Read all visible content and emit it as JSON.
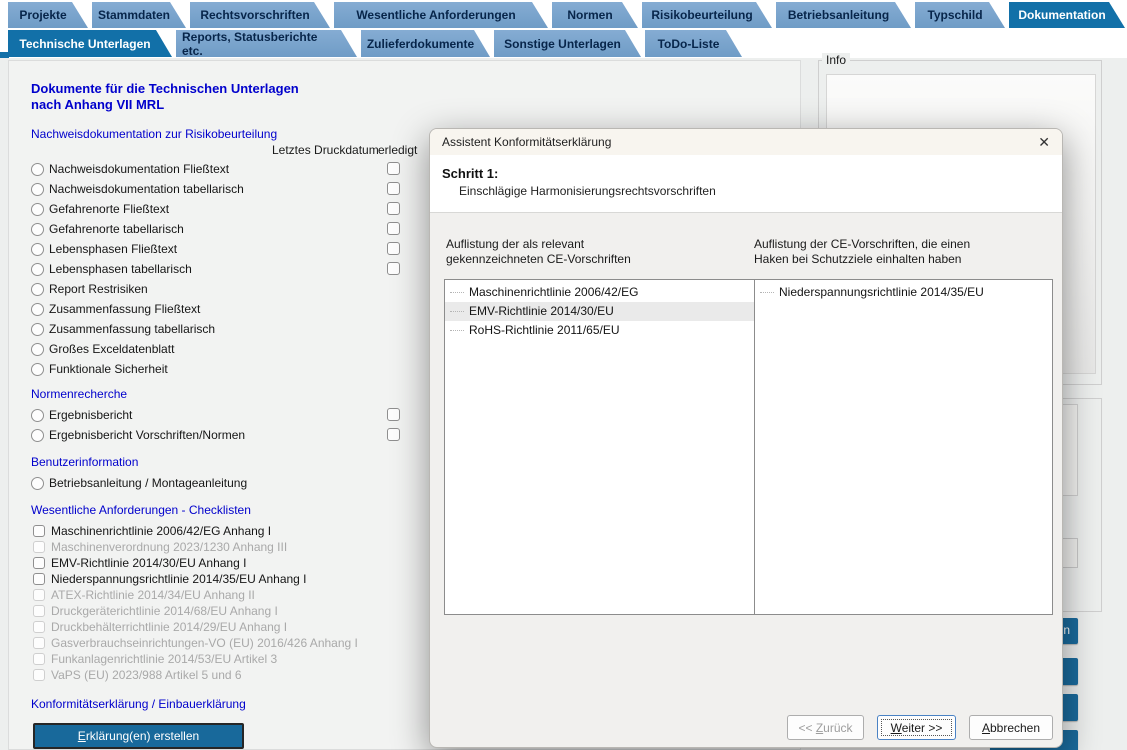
{
  "tabs_top": [
    {
      "label": "Projekte",
      "active": false
    },
    {
      "label": "Stammdaten",
      "active": false
    },
    {
      "label": "Rechtsvorschriften",
      "active": false
    },
    {
      "label": "Wesentliche Anforderungen",
      "active": false
    },
    {
      "label": "Normen",
      "active": false
    },
    {
      "label": "Risikobeurteilung",
      "active": false
    },
    {
      "label": "Betriebsanleitung",
      "active": false
    },
    {
      "label": "Typschild",
      "active": false
    },
    {
      "label": "Dokumentation",
      "active": true
    }
  ],
  "tabs_sub": [
    {
      "label": "Technische Unterlagen",
      "active": true
    },
    {
      "label": "Reports, Statusberichte etc.",
      "active": false
    },
    {
      "label": "Zulieferdokumente",
      "active": false
    },
    {
      "label": "Sonstige Unterlagen",
      "active": false
    },
    {
      "label": "ToDo-Liste",
      "active": false
    }
  ],
  "panel": {
    "title_line1": "Dokumente für die Technischen Unterlagen",
    "title_line2": "nach Anhang VII MRL",
    "col_druckdatum": "Letztes Druckdatum",
    "col_erledigt": "erledigt",
    "groups": [
      {
        "type": "radio",
        "heading": "Nachweisdokumentation zur Risikobeurteilung",
        "items": [
          {
            "label": "Nachweisdokumentation Fließtext",
            "erledigt_box": true
          },
          {
            "label": "Nachweisdokumentation tabellarisch",
            "erledigt_box": true
          },
          {
            "label": "Gefahrenorte Fließtext",
            "erledigt_box": true
          },
          {
            "label": "Gefahrenorte tabellarisch",
            "erledigt_box": true
          },
          {
            "label": "Lebensphasen Fließtext",
            "erledigt_box": true
          },
          {
            "label": "Lebensphasen tabellarisch",
            "erledigt_box": true
          },
          {
            "label": "Report Restrisiken",
            "erledigt_box": false
          },
          {
            "label": "Zusammenfassung Fließtext",
            "erledigt_box": false
          },
          {
            "label": "Zusammenfassung tabellarisch",
            "erledigt_box": false
          },
          {
            "label": "Großes Exceldatenblatt",
            "erledigt_box": false
          },
          {
            "label": "Funktionale Sicherheit",
            "erledigt_box": false
          }
        ]
      },
      {
        "type": "radio",
        "heading": "Normenrecherche",
        "items": [
          {
            "label": "Ergebnisbericht",
            "erledigt_box": true
          },
          {
            "label": "Ergebnisbericht Vorschriften/Normen",
            "erledigt_box": true
          }
        ]
      },
      {
        "type": "radio",
        "heading": "Benutzerinformation",
        "items": [
          {
            "label": "Betriebsanleitung / Montageanleitung",
            "erledigt_box": false
          }
        ]
      },
      {
        "type": "checkbox",
        "heading": "Wesentliche Anforderungen - Checklisten",
        "items": [
          {
            "label": "Maschinenrichtlinie 2006/42/EG Anhang I",
            "enabled": true
          },
          {
            "label": "Maschinenverordnung 2023/1230 Anhang III",
            "enabled": false
          },
          {
            "label": "EMV-Richtlinie 2014/30/EU Anhang I",
            "enabled": true
          },
          {
            "label": "Niederspannungsrichtlinie 2014/35/EU Anhang I",
            "enabled": true
          },
          {
            "label": "ATEX-Richtlinie 2014/34/EU Anhang II",
            "enabled": false
          },
          {
            "label": "Druckgeräterichtlinie 2014/68/EU Anhang I",
            "enabled": false
          },
          {
            "label": "Druckbehälterrichtlinie 2014/29/EU Anhang I",
            "enabled": false
          },
          {
            "label": "Gasverbrauchseinrichtungen-VO (EU) 2016/426 Anhang I",
            "enabled": false
          },
          {
            "label": "Funkanlagenrichtlinie 2014/53/EU Artikel 3",
            "enabled": false
          },
          {
            "label": "VaPS (EU) 2023/988 Artikel 5 und 6",
            "enabled": false
          }
        ]
      }
    ],
    "footer_heading": "Konformitätserklärung / Einbauerklärung",
    "create_button": {
      "pre": "",
      "key": "E",
      "post": "rklärung(en) erstellen"
    }
  },
  "info_panel": {
    "legend": "Info"
  },
  "occluded": {
    "partial_button_text": "n"
  },
  "dialog": {
    "title": "Assistent Konformitätserklärung",
    "close_glyph": "✕",
    "step_title": "Schritt 1:",
    "step_subtitle": "Einschlägige Harmonisierungsrechtsvorschriften",
    "left_list": {
      "label_line1": "Auflistung der als relevant",
      "label_line2": "gekennzeichneten CE-Vorschriften",
      "items": [
        {
          "label": "Maschinenrichtlinie 2006/42/EG",
          "selected": false
        },
        {
          "label": "EMV-Richtlinie 2014/30/EU",
          "selected": true
        },
        {
          "label": "RoHS-Richtlinie 2011/65/EU",
          "selected": false
        }
      ]
    },
    "right_list": {
      "label_line1": "Auflistung der CE-Vorschriften, die einen",
      "label_line2": "Haken bei Schutzziele einhalten haben",
      "items": [
        {
          "label": "Niederspannungsrichtlinie 2014/35/EU",
          "selected": false
        }
      ]
    },
    "buttons": {
      "back": {
        "pre": "<< ",
        "key": "Z",
        "post": "urück",
        "enabled": false
      },
      "next": {
        "pre": "",
        "key": "W",
        "post": "eiter >>",
        "enabled": true,
        "focused": true
      },
      "cancel": {
        "pre": "",
        "key": "A",
        "post": "bbrechen",
        "enabled": true
      }
    }
  },
  "colors": {
    "tab_inactive": "#7aa4cd",
    "tab_active": "#1270a8",
    "heading_blue": "#0000cc",
    "action_blue": "#18699b",
    "disabled_gray": "#a9a9a9"
  }
}
